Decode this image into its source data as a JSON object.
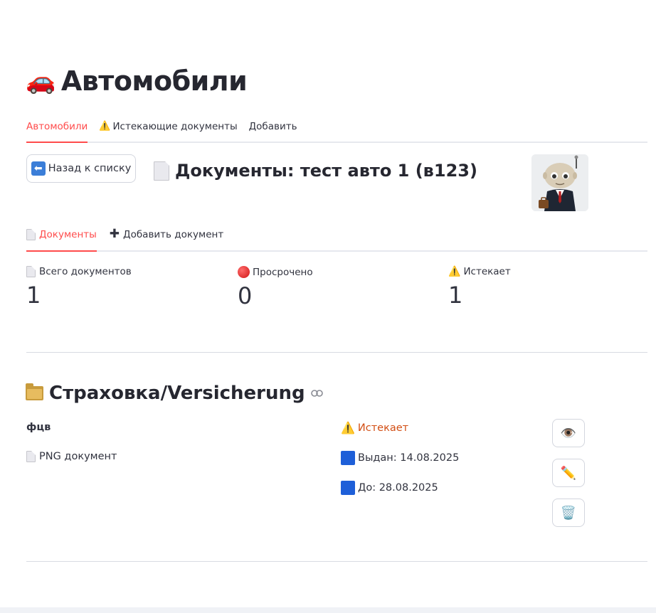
{
  "page": {
    "title_emoji": "🚗",
    "title": "Автомобили"
  },
  "tabs": [
    {
      "label": "Автомобили",
      "icon": "",
      "active": true
    },
    {
      "label": "Истекающие документы",
      "icon": "⚠️",
      "active": false
    },
    {
      "label": "Добавить",
      "icon": "",
      "active": false
    }
  ],
  "back_button": {
    "icon": "⬅",
    "label": "Назад к списку"
  },
  "doc_header": {
    "title": "Документы: тест авто 1 (в123)"
  },
  "subtabs": [
    {
      "label": "Документы",
      "active": true
    },
    {
      "label": "Добавить документ",
      "active": false
    }
  ],
  "metrics": [
    {
      "label": "Всего документов",
      "value": "1",
      "icon": "page-icon"
    },
    {
      "label": "Просрочено",
      "value": "0",
      "icon": "red-circle-icon"
    },
    {
      "label": "Истекает",
      "value": "1",
      "icon": "warning-icon"
    }
  ],
  "section": {
    "title": "Страховка/Versicherung",
    "link_icon": "🔗"
  },
  "document": {
    "name": "фцв",
    "type": "PNG документ",
    "status_icon": "⚠️",
    "status": "Истекает",
    "issued": "Выдан: 14.08.2025",
    "until": "До: 28.08.2025"
  },
  "actions": {
    "view_icon": "👁️",
    "edit_icon": "✏️",
    "delete_icon": "🗑️"
  },
  "colors": {
    "accent": "#ff4b4b",
    "status_warning": "#d24e14",
    "date_marker": "#1e5fd8"
  }
}
